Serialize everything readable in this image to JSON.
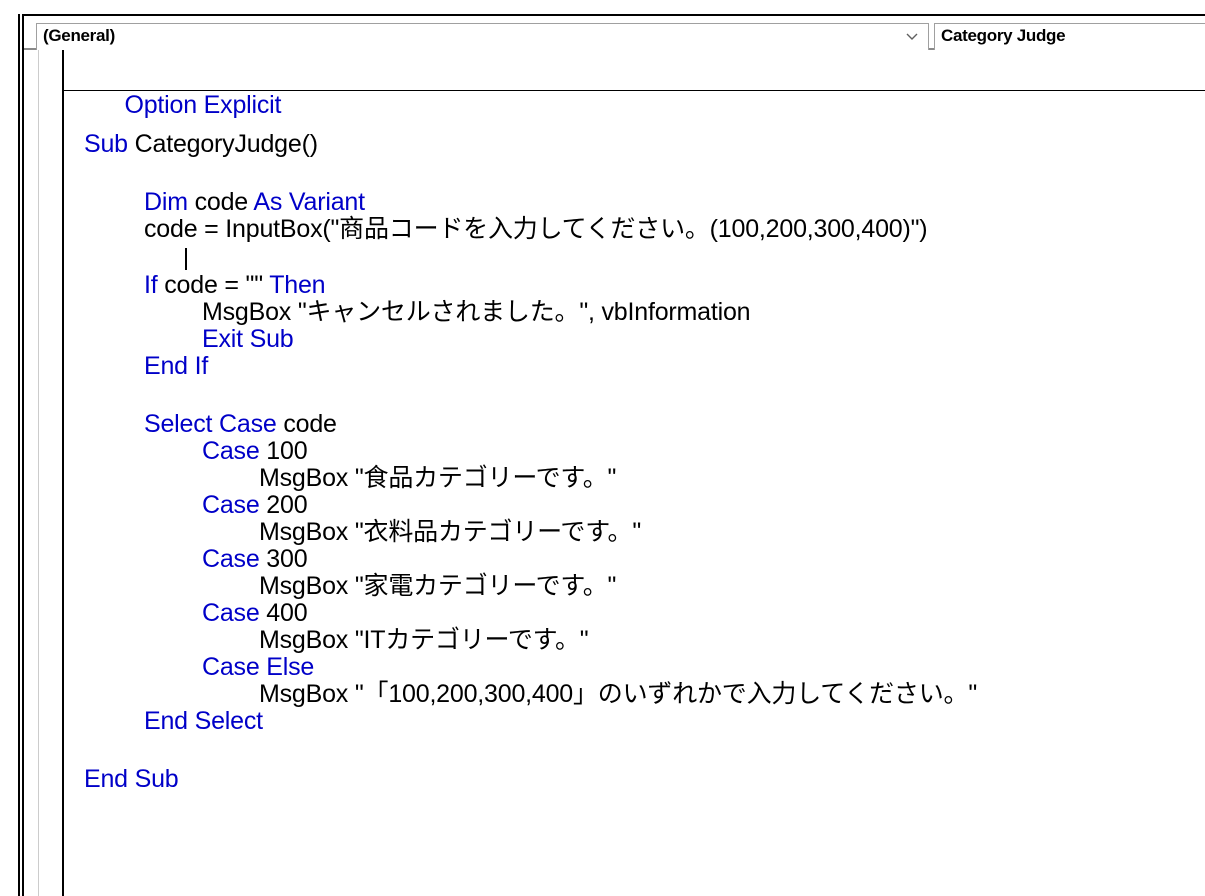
{
  "toolbar": {
    "object_combo": "(General)",
    "procedure_combo": "Category Judge"
  },
  "code": {
    "option_kw": "Option Explicit",
    "sub_kw": "Sub",
    "sub_name": " CategoryJudge()",
    "dim_kw": "Dim",
    "dim_var": " code ",
    "as_variant": "As Variant",
    "inputbox_line": "code = InputBox(\"商品コードを入力してください。(100,200,300,400)\")",
    "if_kw": "If",
    "if_cond": " code = \"\" ",
    "then_kw": "Then",
    "msgbox_cancel": "MsgBox \"キャンセルされました。\", vbInformation",
    "exit_sub": "Exit Sub",
    "end_if": "End If",
    "select_case_kw": "Select Case",
    "select_var": " code",
    "case_kw": "Case",
    "case_100": " 100",
    "msg_100": "MsgBox \"食品カテゴリーです。\"",
    "case_200": " 200",
    "msg_200": "MsgBox \"衣料品カテゴリーです。\"",
    "case_300": " 300",
    "msg_300": "MsgBox \"家電カテゴリーです。\"",
    "case_400": " 400",
    "msg_400": "MsgBox \"ITカテゴリーです。\"",
    "case_else": "Case Else",
    "msg_else": "MsgBox \"「100,200,300,400」のいずれかで入力してください。\"",
    "end_select": "End Select",
    "end_sub": "End Sub"
  },
  "colors": {
    "keyword": "#0000c8",
    "text": "#000000"
  },
  "icons": {
    "dropdown": "chevron-down-icon"
  }
}
